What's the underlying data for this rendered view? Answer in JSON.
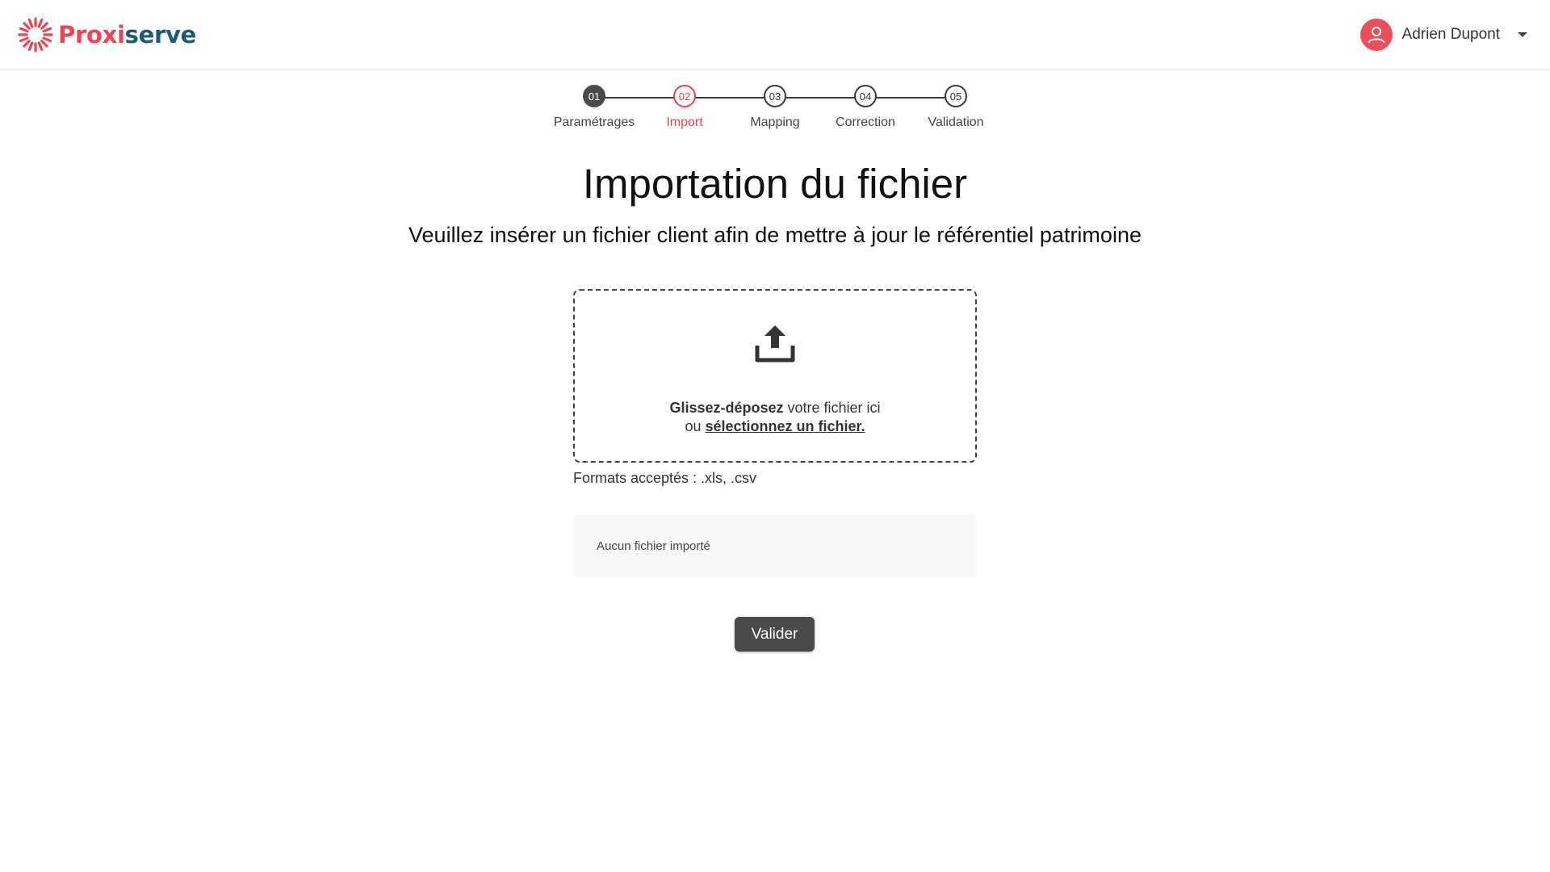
{
  "header": {
    "logo": {
      "part1": "Proxi",
      "part2": "serve"
    },
    "user": {
      "name": "Adrien Dupont"
    }
  },
  "stepper": {
    "steps": [
      {
        "number": "01",
        "label": "Paramétrages",
        "state": "done"
      },
      {
        "number": "02",
        "label": "Import",
        "state": "active"
      },
      {
        "number": "03",
        "label": "Mapping",
        "state": "pending"
      },
      {
        "number": "04",
        "label": "Correction",
        "state": "pending"
      },
      {
        "number": "05",
        "label": "Validation",
        "state": "pending"
      }
    ]
  },
  "main": {
    "title": "Importation du fichier",
    "subtitle": "Veuillez insérer un fichier client afin de mettre à jour le référentiel patrimoine",
    "dropzone": {
      "bold_text": "Glissez-déposez",
      "text": " votre fichier ici",
      "prefix": "ou ",
      "link_text": "sélectionnez un fichier."
    },
    "formats": "Formats acceptés : .xls, .csv",
    "file_status": "Aucun fichier importé",
    "validate_label": "Valider"
  },
  "colors": {
    "brand_red": "#e84555",
    "brand_blue": "#1d5a73",
    "dark_button": "#4a4a4a"
  }
}
